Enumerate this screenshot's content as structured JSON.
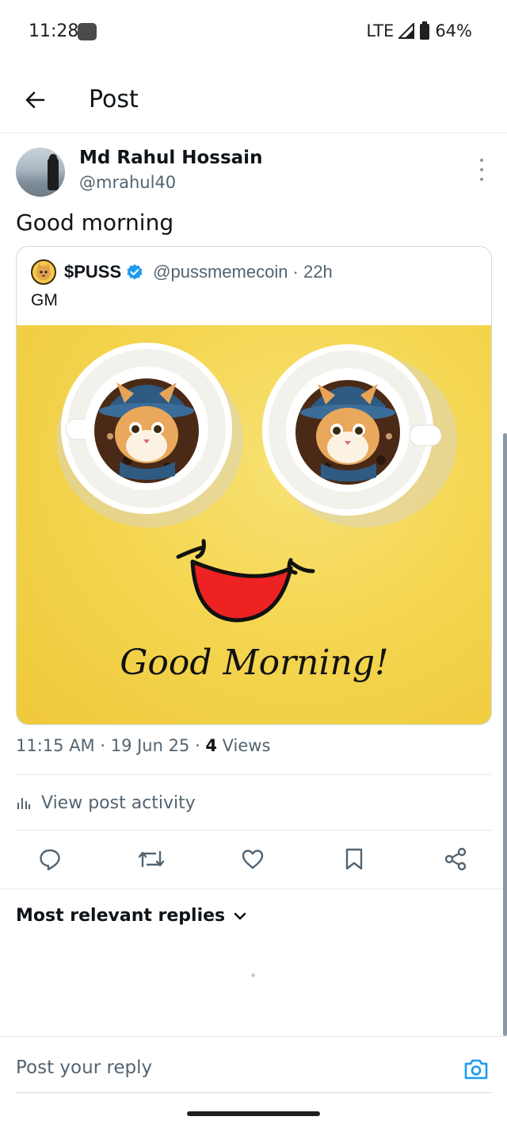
{
  "status_bar": {
    "time": "11:28",
    "network": "LTE",
    "battery": "64%"
  },
  "header": {
    "title": "Post",
    "back_icon": "arrow-left-icon"
  },
  "post": {
    "author_name": "Md Rahul Hossain",
    "author_handle": "@mrahul40",
    "text": "Good morning",
    "timestamp": "11:15 AM · 19 Jun 25 · ",
    "views_count": "4",
    "views_label": " Views",
    "activity_label": "View post activity"
  },
  "quoted_post": {
    "name": "$PUSS",
    "handle": "@pussmemecoin · 22h",
    "text": "GM",
    "verified": true,
    "image_caption": "Good Morning!"
  },
  "actions": {
    "reply_icon": "reply-icon",
    "repost_icon": "repost-icon",
    "like_icon": "heart-icon",
    "bookmark_icon": "bookmark-icon",
    "share_icon": "share-icon"
  },
  "replies": {
    "sort_label": "Most relevant replies"
  },
  "composer": {
    "placeholder": "Post your reply"
  },
  "colors": {
    "accent": "#1d9bf0",
    "text_primary": "#0f1419",
    "text_secondary": "#536471",
    "border": "#e7e9ea"
  }
}
